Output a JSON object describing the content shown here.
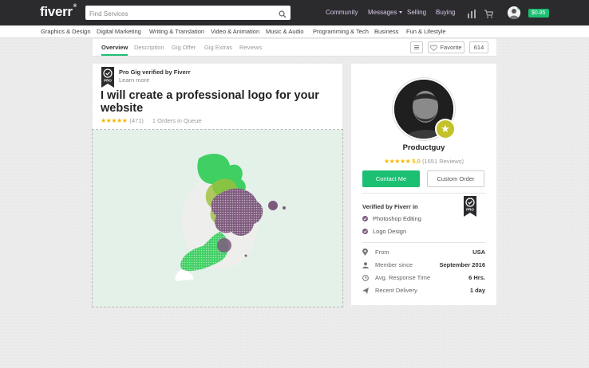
{
  "header": {
    "logo": "fiverr",
    "logo_mark": "®",
    "search_placeholder": "Find Services",
    "nav": [
      "Community",
      "Messages",
      "Selling",
      "Buying"
    ],
    "balance": "$0.85"
  },
  "categories": [
    "Graphics & Design",
    "Digital Marketing",
    "Writing & Translation",
    "Video & Animation",
    "Music & Audio",
    "Programming & Tech",
    "Business",
    "Fun & Lifestyle"
  ],
  "tabs": {
    "items": [
      "Overview",
      "Description",
      "Gig Offer",
      "Gig Extras",
      "Reviews"
    ],
    "active": "Overview",
    "favorite_label": "Favorite",
    "favorite_count": "614"
  },
  "gig": {
    "pro_title": "Pro Gig verified by Fiverr",
    "learn_more": "Learn more",
    "title": "I will create a professional logo for your website",
    "stars": "★★★★★",
    "review_count": "(471)",
    "queue": "1 Orders in Queue"
  },
  "seller": {
    "name": "Productguy",
    "stars": "★★★★★",
    "score": "5.0",
    "reviews": "(1651 Reviews)",
    "contact_label": "Contact Me",
    "custom_label": "Custom Order",
    "verified_title": "Verified by Fiverr in",
    "skills": [
      "Photoshop Editing",
      "Logo Design"
    ],
    "info": [
      {
        "label": "From",
        "value": "USA",
        "icon": "location-icon"
      },
      {
        "label": "Member since",
        "value": "September 2016",
        "icon": "user-icon"
      },
      {
        "label": "Avg. Response Time",
        "value": "6 Hrs.",
        "icon": "clock-icon"
      },
      {
        "label": "Recent Delivery",
        "value": "1 day",
        "icon": "send-icon"
      }
    ],
    "pro_badge_text": "PRO"
  },
  "colors": {
    "accent": "#1dbf73",
    "topbar": "#2b2b2e",
    "star": "#f2b600",
    "pro_badge": "#c4c229"
  }
}
